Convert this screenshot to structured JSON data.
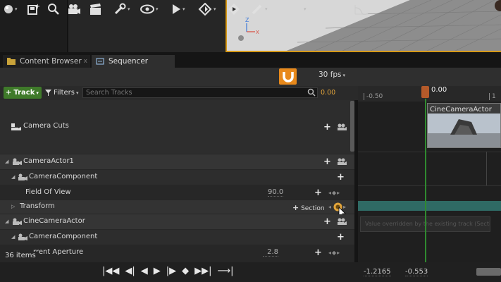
{
  "tabs": [
    {
      "label": "Content Browser",
      "close": "x"
    },
    {
      "label": "Sequencer"
    }
  ],
  "toolbar": {
    "fps": "30 fps",
    "caret": "▾"
  },
  "filterbar": {
    "track_label": "Track",
    "filters_label": "Filters",
    "search_placeholder": "Search Tracks",
    "current_time": "0.00"
  },
  "tree": {
    "rows": [
      {
        "label": "Camera Cuts"
      },
      {
        "label": "CameraActor1"
      },
      {
        "label": "CameraComponent"
      },
      {
        "label": "Field Of View",
        "value": "90.0"
      },
      {
        "label": "Transform",
        "section_label": "Section"
      },
      {
        "label": "CineCameraActor"
      },
      {
        "label": "CameraComponent"
      },
      {
        "label": "rrent Aperture",
        "value": "2.8"
      }
    ],
    "item_count": "36 items"
  },
  "timeline": {
    "tick_neg": "-0.50",
    "tick_pos": "1",
    "playhead_time": "0.00",
    "shot_label": "CineCameraActor",
    "tooltip_text": "Value overridden by the existing track (Section)"
  },
  "bottom": {
    "range_start": "-1.2165",
    "range_end": "-0.553"
  },
  "colors": {
    "accent_orange": "#e8891b",
    "playhead_green": "#2f8a2f",
    "track_green": "#3f7a2a",
    "teal_section": "#2f6a64"
  }
}
